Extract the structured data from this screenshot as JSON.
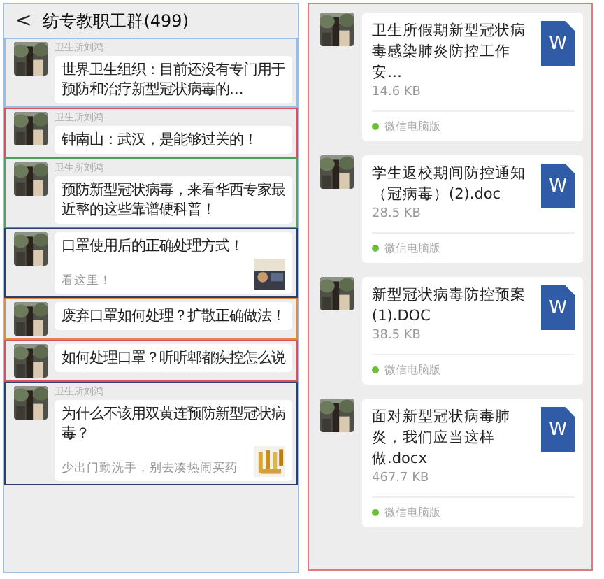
{
  "chat": {
    "back": "<",
    "title": "纺专教职工群(499)",
    "messages": [
      {
        "kind": "text",
        "color": "#9dbde0",
        "sender": "卫生所刘鸿",
        "text": "世界卫生组织：目前还没有专门用于预防和治疗新型冠状病毒的…"
      },
      {
        "kind": "text",
        "color": "#e0505a",
        "sender": "卫生所刘鸿",
        "text": "钟南山：武汉，是能够过关的！"
      },
      {
        "kind": "text",
        "color": "#5aa05a",
        "sender": "卫生所刘鸿",
        "text": "预防新型冠状病毒，来看华西专家最近整的这些靠谱硬科普！"
      },
      {
        "kind": "link",
        "color": "#2c3e6b",
        "text": "口罩使用后的正确处理方式！",
        "desc": "看这里！"
      },
      {
        "kind": "text",
        "color": "#e08a3c",
        "text": "废弃口罩如何处理？扩散正确做法！"
      },
      {
        "kind": "text",
        "color": "#e0505a",
        "text": "如何处理口罩？听听郫都疾控怎么说"
      },
      {
        "kind": "link",
        "color": "#2c3e6b",
        "sender": "卫生所刘鸿",
        "text": "为什么不该用双黄连预防新型冠状病毒？",
        "desc": "少出门勤洗手，别去凑热闹买药"
      }
    ]
  },
  "files": [
    {
      "name": "卫生所假期新型冠状病毒感染肺炎防控工作安…",
      "size": "14.6 KB",
      "icon_label": "W",
      "source": "微信电脑版"
    },
    {
      "name": "学生返校期间防控通知（冠病毒）(2).doc",
      "size": "28.5 KB",
      "icon_label": "W",
      "source": "微信电脑版"
    },
    {
      "name": "新型冠状病毒防控预案(1).DOC",
      "size": "38.5 KB",
      "icon_label": "W",
      "source": "微信电脑版"
    },
    {
      "name": "面对新型冠状病毒肺炎，我们应当这样做.docx",
      "size": "467.7 KB",
      "icon_label": "W",
      "source": "微信电脑版"
    }
  ]
}
